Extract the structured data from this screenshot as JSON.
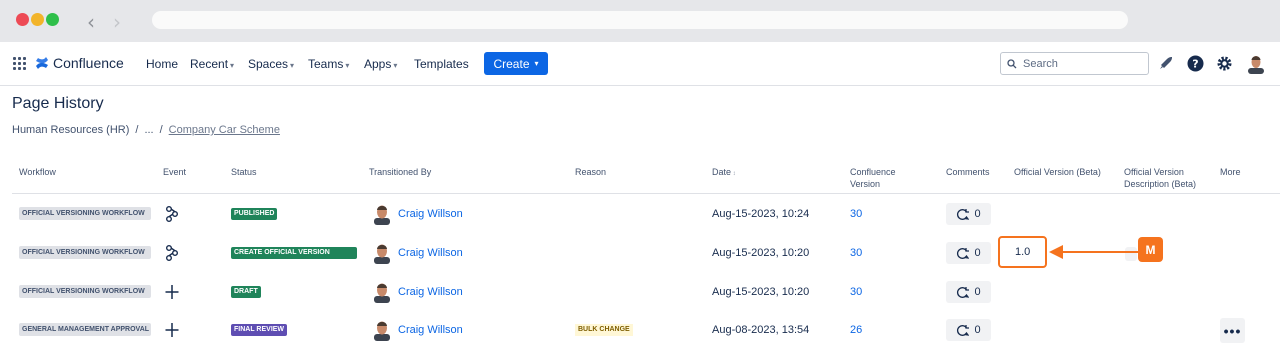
{
  "app": {
    "name": "Confluence"
  },
  "nav": {
    "items": [
      {
        "label": "Home",
        "has_menu": false
      },
      {
        "label": "Recent",
        "has_menu": true
      },
      {
        "label": "Spaces",
        "has_menu": true
      },
      {
        "label": "Teams",
        "has_menu": true
      },
      {
        "label": "Apps",
        "has_menu": true
      },
      {
        "label": "Templates",
        "has_menu": false
      }
    ],
    "create_label": "Create",
    "search_placeholder": "Search"
  },
  "page": {
    "title": "Page History",
    "breadcrumb": [
      "Human Resources (HR)",
      "...",
      "Company Car Scheme"
    ]
  },
  "table": {
    "columns": [
      "Workflow",
      "Event",
      "Status",
      "Transitioned By",
      "Reason",
      "Date",
      "Confluence Version",
      "Comments",
      "Official Version (Beta)",
      "Official Version Description (Beta)",
      "More"
    ],
    "rows": [
      {
        "workflow": "OFFICIAL VERSIONING WORKFLOW",
        "event_icon": "workflow-icon",
        "status": "PUBLISHED",
        "status_color": "#1f845a",
        "user": "Craig Willson",
        "reason": "",
        "date": "Aug-15-2023, 10:24",
        "version": "30",
        "comments": "0",
        "official_version": ""
      },
      {
        "workflow": "OFFICIAL VERSIONING WORKFLOW",
        "event_icon": "workflow-icon",
        "status": "CREATE OFFICIAL VERSION",
        "status_color": "#1f845a",
        "user": "Craig Willson",
        "reason": "",
        "date": "Aug-15-2023, 10:20",
        "version": "30",
        "comments": "0",
        "official_version": "1.0"
      },
      {
        "workflow": "OFFICIAL VERSIONING WORKFLOW",
        "event_icon": "plus-icon",
        "status": "DRAFT",
        "status_color": "#1f845a",
        "user": "Craig Willson",
        "reason": "",
        "date": "Aug-15-2023, 10:20",
        "version": "30",
        "comments": "0",
        "official_version": ""
      },
      {
        "workflow": "GENERAL MANAGEMENT APPROVAL",
        "event_icon": "plus-icon",
        "status": "FINAL REVIEW",
        "status_color": "#5e4db2",
        "user": "Craig Willson",
        "reason": "BULK CHANGE",
        "date": "Aug-08-2023, 13:54",
        "version": "26",
        "comments": "0",
        "official_version": ""
      }
    ]
  },
  "annotation": {
    "badge": "M",
    "color": "#f5731e"
  }
}
